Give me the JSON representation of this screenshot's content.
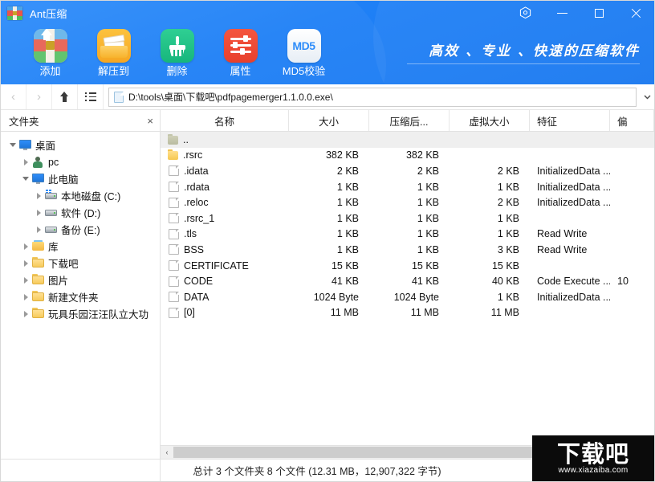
{
  "window": {
    "title": "Ant压缩",
    "app_icon": "archive-icon",
    "controls": {
      "settings": "settings-hex-icon",
      "minimize": "minimize-icon",
      "maximize": "maximize-icon",
      "close": "close-icon"
    }
  },
  "toolbar": {
    "slogan": "高效 、专业 、快速的压缩软件",
    "buttons": [
      {
        "label": "添加",
        "icon": "add-archive-icon"
      },
      {
        "label": "解压到",
        "icon": "extract-folder-icon"
      },
      {
        "label": "删除",
        "icon": "broom-delete-icon"
      },
      {
        "label": "属性",
        "icon": "sliders-properties-icon"
      },
      {
        "label": "MD5校验",
        "icon": "md5-badge-icon",
        "icon_text": "MD5"
      }
    ]
  },
  "addressbar": {
    "back": "chevron-left-icon",
    "forward": "chevron-right-icon",
    "up": "arrow-up-icon",
    "list": "list-view-icon",
    "path": "D:\\tools\\桌面\\下载吧\\pdfpagemerger1.1.0.0.exe\\",
    "dropdown": "chevron-down-icon"
  },
  "sidebar": {
    "title": "文件夹",
    "close": "×",
    "items": [
      {
        "label": "桌面",
        "indent": 0,
        "icon": "monitor-icon",
        "twisty": "open"
      },
      {
        "label": "pc",
        "indent": 1,
        "icon": "user-icon",
        "twisty": "closed"
      },
      {
        "label": "此电脑",
        "indent": 1,
        "icon": "monitor-icon",
        "twisty": "open"
      },
      {
        "label": "本地磁盘 (C:)",
        "indent": 2,
        "icon": "drive-win-icon",
        "twisty": "closed"
      },
      {
        "label": "软件 (D:)",
        "indent": 2,
        "icon": "drive-icon",
        "twisty": "closed"
      },
      {
        "label": "备份 (E:)",
        "indent": 2,
        "icon": "drive-icon",
        "twisty": "closed"
      },
      {
        "label": "库",
        "indent": 1,
        "icon": "library-icon",
        "twisty": "closed"
      },
      {
        "label": "下载吧",
        "indent": 1,
        "icon": "folder-icon",
        "twisty": "closed"
      },
      {
        "label": "图片",
        "indent": 1,
        "icon": "folder-icon",
        "twisty": "closed"
      },
      {
        "label": "新建文件夹",
        "indent": 1,
        "icon": "folder-icon",
        "twisty": "closed"
      },
      {
        "label": "玩具乐园汪汪队立大功",
        "indent": 1,
        "icon": "folder-icon",
        "twisty": "closed"
      }
    ]
  },
  "filelist": {
    "columns": [
      "名称",
      "大小",
      "压缩后...",
      "虚拟大小",
      "特征",
      "偏"
    ],
    "rows": [
      {
        "name": "..",
        "icon": "parent-folder-icon",
        "size": "",
        "packed": "",
        "virtual": "",
        "feature": "",
        "offset": ""
      },
      {
        "name": ".rsrc",
        "icon": "folder-icon",
        "size": "382 KB",
        "packed": "382 KB",
        "virtual": "",
        "feature": "",
        "offset": ""
      },
      {
        "name": ".idata",
        "icon": "file-icon",
        "size": "2 KB",
        "packed": "2 KB",
        "virtual": "2 KB",
        "feature": "InitializedData ...",
        "offset": ""
      },
      {
        "name": ".rdata",
        "icon": "file-icon",
        "size": "1 KB",
        "packed": "1 KB",
        "virtual": "1 KB",
        "feature": "InitializedData ...",
        "offset": ""
      },
      {
        "name": ".reloc",
        "icon": "file-icon",
        "size": "1 KB",
        "packed": "1 KB",
        "virtual": "2 KB",
        "feature": "InitializedData ...",
        "offset": ""
      },
      {
        "name": ".rsrc_1",
        "icon": "file-icon",
        "size": "1 KB",
        "packed": "1 KB",
        "virtual": "1 KB",
        "feature": "",
        "offset": ""
      },
      {
        "name": ".tls",
        "icon": "file-icon",
        "size": "1 KB",
        "packed": "1 KB",
        "virtual": "1 KB",
        "feature": "Read Write",
        "offset": ""
      },
      {
        "name": "BSS",
        "icon": "file-icon",
        "size": "1 KB",
        "packed": "1 KB",
        "virtual": "3 KB",
        "feature": "Read Write",
        "offset": ""
      },
      {
        "name": "CERTIFICATE",
        "icon": "file-icon",
        "size": "15 KB",
        "packed": "15 KB",
        "virtual": "15 KB",
        "feature": "",
        "offset": ""
      },
      {
        "name": "CODE",
        "icon": "file-icon",
        "size": "41 KB",
        "packed": "41 KB",
        "virtual": "40 KB",
        "feature": "Code Execute ...",
        "offset": "10"
      },
      {
        "name": "DATA",
        "icon": "file-icon",
        "size": "1024 Byte",
        "packed": "1024 Byte",
        "virtual": "1 KB",
        "feature": "InitializedData ...",
        "offset": ""
      },
      {
        "name": "[0]",
        "icon": "file-icon",
        "size": "11 MB",
        "packed": "11 MB",
        "virtual": "11 MB",
        "feature": "",
        "offset": ""
      }
    ],
    "scroll_left_arrow": "‹"
  },
  "statusbar": {
    "text": "总计 3 个文件夹 8 个文件 (12.31 MB，12,907,322 字节)"
  },
  "watermark": {
    "main": "下载吧",
    "sub": "www.xiazaiba.com"
  },
  "colors": {
    "header_blue": "#1f80f6",
    "accent": "#2f8dfa",
    "folder_yellow": "#f6c851",
    "delete_green": "#17b67c",
    "properties_red": "#e8402c"
  }
}
